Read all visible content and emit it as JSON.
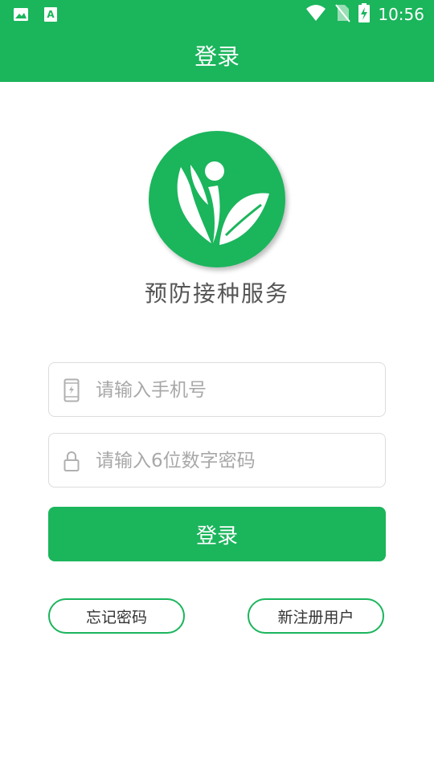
{
  "status_bar": {
    "time": "10:56",
    "icons": [
      "image-icon",
      "a-icon",
      "wifi-icon",
      "no-sim-icon",
      "battery-charging-icon"
    ]
  },
  "header": {
    "title": "登录"
  },
  "app": {
    "name": "预防接种服务"
  },
  "form": {
    "phone": {
      "placeholder": "请输入手机号",
      "value": "",
      "icon": "phone-icon"
    },
    "password": {
      "placeholder": "请输入6位数字密码",
      "value": "",
      "icon": "lock-icon"
    },
    "login_label": "登录"
  },
  "links": {
    "forgot_label": "忘记密码",
    "register_label": "新注册用户"
  },
  "colors": {
    "brand": "#1bb55c",
    "text": "#555555",
    "placeholder": "#a8a8a8"
  }
}
